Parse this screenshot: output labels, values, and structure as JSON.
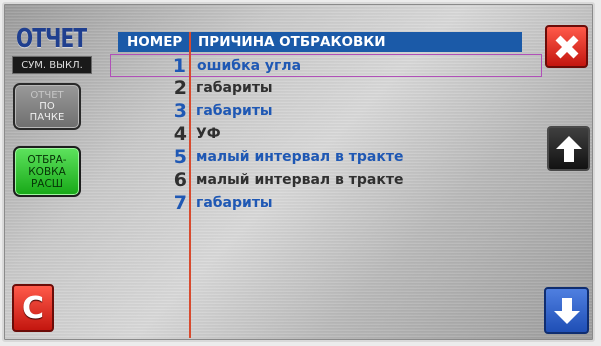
{
  "title": "ОТЧЕТ",
  "left_panel": {
    "sum_label": "СУМ. ВЫКЛ.",
    "report_by_pack": {
      "line1": "ОТЧЕТ",
      "line2": "ПО",
      "line3": "ПАЧКЕ"
    },
    "reject_btn": {
      "line1": "ОТБРА-",
      "line2": "КОВКА",
      "line3": "РАСШ"
    },
    "c_label": "C"
  },
  "table": {
    "col_number": "НОМЕР",
    "col_reason": "ПРИЧИНА ОТБРАКОВКИ",
    "rows": [
      {
        "num": "1",
        "reason": "ошибка угла",
        "color": "blue",
        "selected": true
      },
      {
        "num": "2",
        "reason": "габариты",
        "color": "gray"
      },
      {
        "num": "3",
        "reason": "габариты",
        "color": "blue"
      },
      {
        "num": "4",
        "reason": "УФ",
        "color": "gray"
      },
      {
        "num": "5",
        "reason": "малый интервал в тракте",
        "color": "blue"
      },
      {
        "num": "6",
        "reason": "малый интервал в тракте",
        "color": "gray"
      },
      {
        "num": "7",
        "reason": "габариты",
        "color": "blue"
      }
    ]
  },
  "icons": {
    "close": "close-icon",
    "up": "arrow-up-icon",
    "down": "arrow-down-icon"
  },
  "colors": {
    "accent_blue": "#1b5aa8",
    "row_blue": "#1f58b4",
    "row_gray": "#303030",
    "divider_red": "#d84a2e",
    "selection_outline": "#b050b8",
    "danger_red": "#c3160f",
    "active_green": "#17a817"
  }
}
